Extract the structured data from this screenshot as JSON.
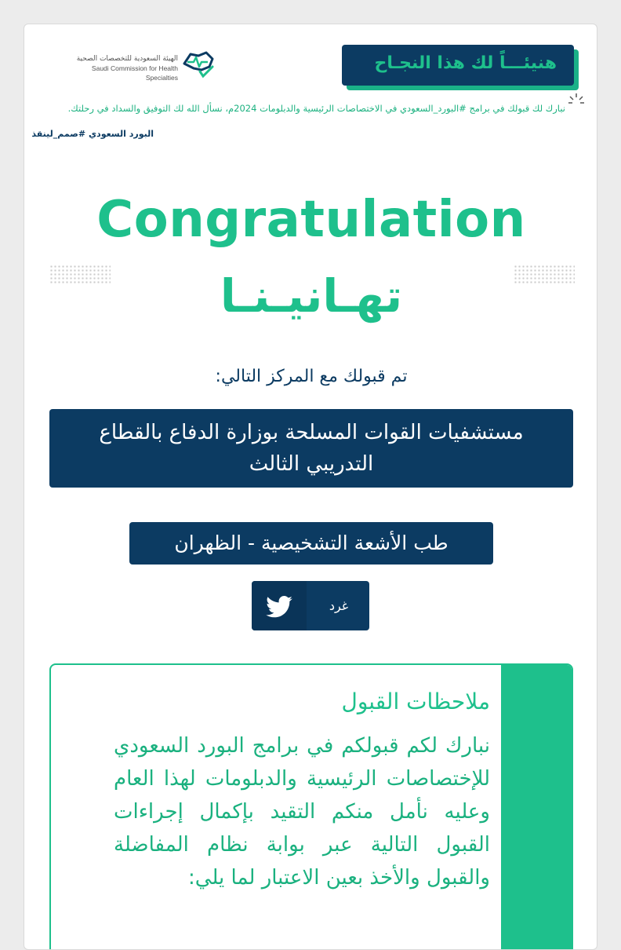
{
  "header": {
    "logo_ar": "الهيئة السعودية للتخصصات الصحية",
    "logo_en": "Saudi Commission for Health Specialties",
    "banner": "هنيئـــاً لك هذا النجـاح",
    "message": "نبارك لك قبولك في برامج #البورد_السعودي في الاختصاصات الرئيسية والدبلومات 2024م، نسأل الله لك التوفيق والسداد في رحلتك.",
    "hashtags": "البورد السعودي #صمم_لينقذ"
  },
  "hero": {
    "title_en": "Congratulation",
    "title_ar": "تهـانيـنـا"
  },
  "acceptance": {
    "intro": "تم قبولك مع المركز التالي:",
    "center_line1": "مستشفيات القوات المسلحة بوزارة الدفاع بالقطاع",
    "center_line2": "التدريبي الثالث",
    "specialty": "طب الأشعة التشخيصية - الظهران"
  },
  "share": {
    "label": "غرد",
    "icon": "twitter-icon"
  },
  "notes": {
    "title": "ملاحظات القبول",
    "body": "نبارك لكم قبولكم في برامج البورد السعودي للإختصاصات الرئيسية والدبلومات لهذا العام وعليه نأمل منكم التقيد بإكمال إجراءات القبول التالية عبر بوابة نظام المفاضلة والقبول والأخذ بعين الاعتبار لما يلي:"
  },
  "colors": {
    "navy": "#0c3b62",
    "green": "#1ec08c",
    "text_green": "#1ab17f"
  }
}
